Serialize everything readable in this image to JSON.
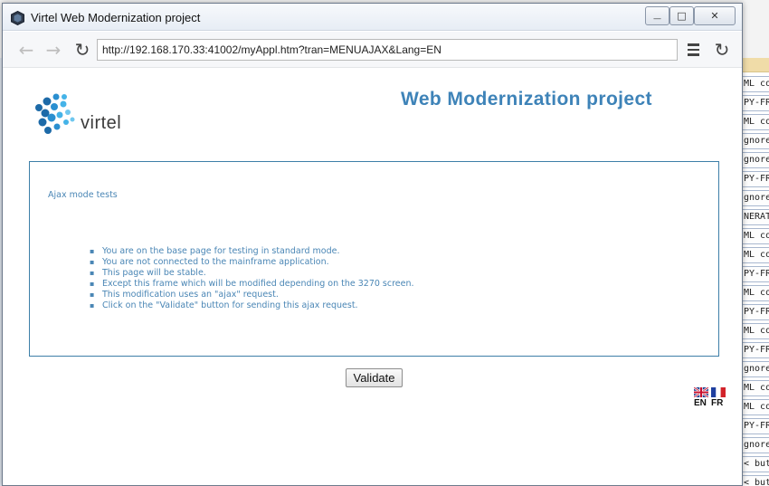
{
  "window": {
    "title": "Virtel Web Modernization project",
    "controls": {
      "minimize": "—",
      "maximize": "□",
      "close": "✕"
    }
  },
  "toolbar": {
    "back_icon": "←",
    "forward_icon": "→",
    "reload_icon": "↻",
    "url": "http://192.168.170.33:41002/myAppl.htm?tran=MENUAJAX&Lang=EN"
  },
  "page": {
    "logo_text": "virtel",
    "title": "Web Modernization project",
    "panel": {
      "heading": "Ajax mode tests",
      "items": [
        "You are on the base page for testing in standard mode.",
        "You are not connected to the mainframe application.",
        "This page will be stable.",
        "Except this frame which will be modified depending on the 3270 screen.",
        "This modification uses an \"ajax\" request.",
        "Click on the \"Validate\" button for sending this ajax request."
      ]
    },
    "validate_label": "Validate",
    "languages": [
      {
        "code": "EN"
      },
      {
        "code": "FR"
      }
    ]
  },
  "background_app": {
    "rows": [
      "ML co",
      "PY-FR",
      "ML co",
      "gnore",
      "gnore",
      "PY-FR",
      "gnore",
      "NERAT",
      "ML co",
      "ML co",
      "PY-FR",
      "ML co",
      "PY-FR",
      "ML co",
      "PY-FR",
      "gnore",
      "ML co",
      "ML co",
      "PY-FR",
      "gnore",
      "< butt",
      "< butt"
    ]
  },
  "colors": {
    "accent": "#3e83b8",
    "panel_border": "#3d7fa8",
    "text_blue": "#4a86b5"
  }
}
